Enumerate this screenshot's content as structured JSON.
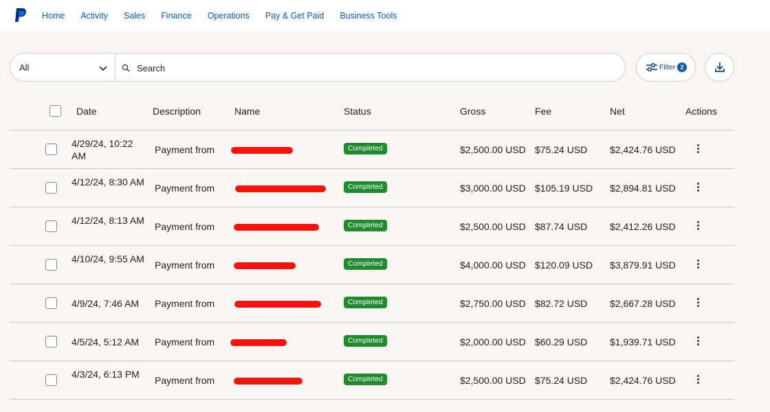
{
  "nav": {
    "items": [
      "Home",
      "Activity",
      "Sales",
      "Finance",
      "Operations",
      "Pay & Get Paid",
      "Business Tools"
    ]
  },
  "search": {
    "type_value": "All",
    "placeholder": "Search"
  },
  "filter": {
    "label": "Filter",
    "count": "2"
  },
  "table": {
    "headers": {
      "date": "Date",
      "description": "Description",
      "name": "Name",
      "status": "Status",
      "gross": "Gross",
      "fee": "Fee",
      "net": "Net",
      "actions": "Actions"
    },
    "rows": [
      {
        "date": "4/29/24, 10:22 AM",
        "description": "Payment from",
        "name": "[redacted]",
        "status": "Completed",
        "gross": "$2,500.00 USD",
        "fee": "$75.24 USD",
        "net": "$2,424.76 USD"
      },
      {
        "date": "4/12/24, 8:30 AM",
        "description": "Payment from",
        "name": "[redacted]",
        "status": "Completed",
        "gross": "$3,000.00 USD",
        "fee": "$105.19 USD",
        "net": "$2,894.81 USD"
      },
      {
        "date": "4/12/24, 8:13 AM",
        "description": "Payment from",
        "name": "[redacted]",
        "status": "Completed",
        "gross": "$2,500.00 USD",
        "fee": "$87.74 USD",
        "net": "$2,412.26 USD"
      },
      {
        "date": "4/10/24, 9:55 AM",
        "description": "Payment from",
        "name": "[redacted]",
        "status": "Completed",
        "gross": "$4,000.00 USD",
        "fee": "$120.09 USD",
        "net": "$3,879.91 USD"
      },
      {
        "date": "4/9/24, 7:46 AM",
        "description": "Payment from",
        "name": "[redacted]",
        "status": "Completed",
        "gross": "$2,750.00 USD",
        "fee": "$82.72 USD",
        "net": "$2,667.28 USD"
      },
      {
        "date": "4/5/24, 5:12 AM",
        "description": "Payment from",
        "name": "[redacted]",
        "status": "Completed",
        "gross": "$2,000.00 USD",
        "fee": "$60.29 USD",
        "net": "$1,939.71 USD"
      },
      {
        "date": "4/3/24, 6:13 PM",
        "description": "Payment from",
        "name": "[redacted]",
        "status": "Completed",
        "gross": "$2,500.00 USD",
        "fee": "$75.24 USD",
        "net": "$2,424.76 USD"
      }
    ]
  },
  "colors": {
    "brand": "#003087",
    "nav_link": "#0b5ab8",
    "status_completed": "#1f8a2e",
    "redaction": "#f5140d"
  },
  "icons": [
    "paypal-logo",
    "chevron-down-icon",
    "search-icon",
    "filter-sliders-icon",
    "download-icon",
    "kebab-menu-icon"
  ]
}
